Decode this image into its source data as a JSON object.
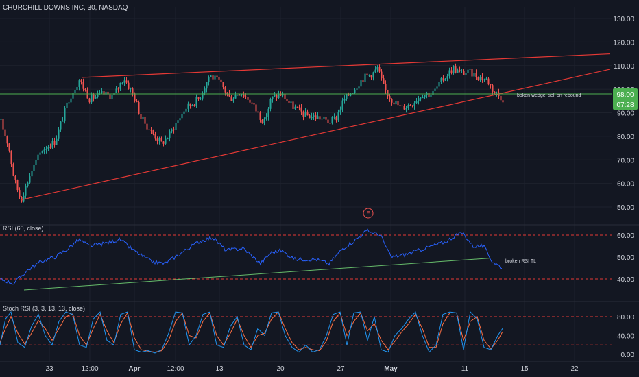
{
  "chart_title": "CHURCHILL DOWNS INC, 30, NASDAQ",
  "colors": {
    "background": "#131722",
    "up": "#26a69a",
    "down": "#ef5350",
    "wedge": "#e53935",
    "price_line": "#4caf50",
    "price_badge": "#4caf50",
    "rsi_line": "#2962ff",
    "rsi_trend": "#66bb6a",
    "stoch_k": "#2196f3",
    "stoch_d": "#ff7043",
    "level": "#e53935",
    "axis_text": "#d1d4dc"
  },
  "price_badge": {
    "price": "98.00",
    "countdown": "07:28"
  },
  "earnings_marker": "E",
  "chart_data": [
    {
      "type": "candlestick",
      "title": "CHURCHILL DOWNS INC, 30, NASDAQ",
      "ylim": [
        48,
        134
      ],
      "yticks": [
        "130.00",
        "120.00",
        "110.00",
        "100.00",
        "90.00",
        "80.00",
        "70.00",
        "60.00",
        "50.00"
      ],
      "xticks": [
        "23",
        "12:00",
        "Apr",
        "12:00",
        "13",
        "20",
        "27",
        "May",
        "11",
        "15",
        "22"
      ],
      "price_path": [
        [
          0,
          87
        ],
        [
          12,
          76
        ],
        [
          20,
          62
        ],
        [
          30,
          53
        ],
        [
          45,
          65
        ],
        [
          60,
          74
        ],
        [
          80,
          78
        ],
        [
          100,
          96
        ],
        [
          115,
          104
        ],
        [
          130,
          96
        ],
        [
          150,
          98
        ],
        [
          165,
          97
        ],
        [
          180,
          105
        ],
        [
          195,
          97
        ],
        [
          205,
          88
        ],
        [
          220,
          82
        ],
        [
          235,
          77
        ],
        [
          245,
          80
        ],
        [
          255,
          85
        ],
        [
          270,
          92
        ],
        [
          290,
          96
        ],
        [
          305,
          106
        ],
        [
          320,
          103
        ],
        [
          335,
          96
        ],
        [
          350,
          99
        ],
        [
          365,
          95
        ],
        [
          375,
          90
        ],
        [
          385,
          86
        ],
        [
          395,
          96
        ],
        [
          410,
          98
        ],
        [
          425,
          93
        ],
        [
          445,
          89
        ],
        [
          465,
          88
        ],
        [
          480,
          86
        ],
        [
          490,
          88
        ],
        [
          500,
          95
        ],
        [
          515,
          100
        ],
        [
          530,
          105
        ],
        [
          545,
          107
        ],
        [
          550,
          109
        ],
        [
          560,
          100
        ],
        [
          570,
          96
        ],
        [
          585,
          92
        ],
        [
          600,
          94
        ],
        [
          615,
          98
        ],
        [
          630,
          98
        ],
        [
          645,
          104
        ],
        [
          660,
          109
        ],
        [
          670,
          107
        ],
        [
          685,
          107
        ],
        [
          700,
          105
        ],
        [
          710,
          104
        ],
        [
          720,
          99
        ],
        [
          733,
          96
        ]
      ],
      "wedge_upper": {
        "from": {
          "x": 120,
          "price": 105
        },
        "to": {
          "x": 890,
          "price": 115
        }
      },
      "wedge_lower": {
        "from": {
          "x": 30,
          "price": 53
        },
        "to": {
          "x": 890,
          "price": 108.5
        }
      },
      "price_level": 98.0,
      "annotation": "boken wedge, sell on rebound"
    },
    {
      "type": "line",
      "title": "RSI (60, close)",
      "ylim": [
        34,
        66
      ],
      "yticks": [
        "60.00",
        "50.00",
        "40.00"
      ],
      "levels": [
        60,
        40
      ],
      "rsi_path": [
        [
          0,
          40
        ],
        [
          20,
          38
        ],
        [
          40,
          44
        ],
        [
          60,
          48
        ],
        [
          80,
          50
        ],
        [
          100,
          54
        ],
        [
          115,
          58
        ],
        [
          130,
          55
        ],
        [
          150,
          56
        ],
        [
          175,
          58
        ],
        [
          195,
          53
        ],
        [
          220,
          48
        ],
        [
          240,
          47
        ],
        [
          270,
          53
        ],
        [
          290,
          57
        ],
        [
          310,
          59
        ],
        [
          330,
          53
        ],
        [
          355,
          54
        ],
        [
          380,
          47
        ],
        [
          395,
          52
        ],
        [
          410,
          53
        ],
        [
          430,
          49
        ],
        [
          460,
          49
        ],
        [
          480,
          47
        ],
        [
          500,
          54
        ],
        [
          515,
          57
        ],
        [
          535,
          62
        ],
        [
          555,
          60
        ],
        [
          570,
          50
        ],
        [
          590,
          51
        ],
        [
          610,
          53
        ],
        [
          630,
          55
        ],
        [
          650,
          57
        ],
        [
          665,
          60
        ],
        [
          675,
          61
        ],
        [
          690,
          55
        ],
        [
          705,
          55
        ],
        [
          718,
          48
        ],
        [
          733,
          45
        ]
      ],
      "trendline": {
        "from": {
          "x": 35,
          "value": 35
        },
        "to": {
          "x": 715,
          "value": 49.5
        }
      },
      "annotation": "broken RSI TL"
    },
    {
      "type": "line",
      "title": "Stoch RSI (3, 3, 13, 13, close)",
      "ylim": [
        -5,
        100
      ],
      "yticks": [
        "80.00",
        "40.00",
        "0.00"
      ],
      "levels": [
        80,
        20
      ],
      "stoch_k": [
        [
          0,
          20
        ],
        [
          8,
          75
        ],
        [
          16,
          90
        ],
        [
          26,
          25
        ],
        [
          36,
          15
        ],
        [
          46,
          60
        ],
        [
          56,
          85
        ],
        [
          66,
          40
        ],
        [
          76,
          20
        ],
        [
          86,
          70
        ],
        [
          96,
          90
        ],
        [
          106,
          85
        ],
        [
          116,
          20
        ],
        [
          126,
          15
        ],
        [
          136,
          75
        ],
        [
          146,
          90
        ],
        [
          156,
          30
        ],
        [
          166,
          20
        ],
        [
          176,
          85
        ],
        [
          186,
          90
        ],
        [
          196,
          10
        ],
        [
          206,
          5
        ],
        [
          216,
          8
        ],
        [
          226,
          3
        ],
        [
          236,
          10
        ],
        [
          246,
          45
        ],
        [
          256,
          90
        ],
        [
          266,
          88
        ],
        [
          276,
          20
        ],
        [
          286,
          40
        ],
        [
          296,
          85
        ],
        [
          306,
          90
        ],
        [
          316,
          20
        ],
        [
          326,
          15
        ],
        [
          336,
          60
        ],
        [
          346,
          80
        ],
        [
          356,
          20
        ],
        [
          366,
          10
        ],
        [
          376,
          55
        ],
        [
          386,
          40
        ],
        [
          396,
          88
        ],
        [
          406,
          90
        ],
        [
          416,
          40
        ],
        [
          426,
          15
        ],
        [
          436,
          5
        ],
        [
          446,
          20
        ],
        [
          456,
          5
        ],
        [
          466,
          10
        ],
        [
          476,
          40
        ],
        [
          486,
          85
        ],
        [
          496,
          90
        ],
        [
          506,
          20
        ],
        [
          516,
          88
        ],
        [
          526,
          90
        ],
        [
          536,
          30
        ],
        [
          546,
          80
        ],
        [
          556,
          10
        ],
        [
          566,
          5
        ],
        [
          576,
          40
        ],
        [
          586,
          55
        ],
        [
          596,
          75
        ],
        [
          606,
          90
        ],
        [
          616,
          40
        ],
        [
          626,
          5
        ],
        [
          636,
          20
        ],
        [
          646,
          85
        ],
        [
          656,
          90
        ],
        [
          666,
          88
        ],
        [
          676,
          10
        ],
        [
          686,
          90
        ],
        [
          696,
          75
        ],
        [
          706,
          15
        ],
        [
          716,
          10
        ],
        [
          726,
          40
        ],
        [
          733,
          55
        ]
      ],
      "stoch_d": [
        [
          0,
          25
        ],
        [
          8,
          55
        ],
        [
          16,
          80
        ],
        [
          26,
          45
        ],
        [
          36,
          22
        ],
        [
          46,
          45
        ],
        [
          56,
          72
        ],
        [
          66,
          55
        ],
        [
          76,
          30
        ],
        [
          86,
          55
        ],
        [
          96,
          80
        ],
        [
          106,
          86
        ],
        [
          116,
          40
        ],
        [
          126,
          20
        ],
        [
          136,
          55
        ],
        [
          146,
          85
        ],
        [
          156,
          50
        ],
        [
          166,
          25
        ],
        [
          176,
          65
        ],
        [
          186,
          88
        ],
        [
          196,
          35
        ],
        [
          206,
          10
        ],
        [
          216,
          7
        ],
        [
          226,
          5
        ],
        [
          236,
          8
        ],
        [
          246,
          30
        ],
        [
          256,
          70
        ],
        [
          266,
          88
        ],
        [
          276,
          40
        ],
        [
          286,
          35
        ],
        [
          296,
          70
        ],
        [
          306,
          88
        ],
        [
          316,
          40
        ],
        [
          326,
          20
        ],
        [
          336,
          45
        ],
        [
          346,
          75
        ],
        [
          356,
          40
        ],
        [
          366,
          15
        ],
        [
          376,
          40
        ],
        [
          386,
          45
        ],
        [
          396,
          75
        ],
        [
          406,
          90
        ],
        [
          416,
          55
        ],
        [
          426,
          25
        ],
        [
          436,
          10
        ],
        [
          446,
          15
        ],
        [
          456,
          10
        ],
        [
          466,
          8
        ],
        [
          476,
          28
        ],
        [
          486,
          70
        ],
        [
          496,
          88
        ],
        [
          506,
          40
        ],
        [
          516,
          70
        ],
        [
          526,
          88
        ],
        [
          536,
          50
        ],
        [
          546,
          65
        ],
        [
          556,
          30
        ],
        [
          566,
          10
        ],
        [
          576,
          28
        ],
        [
          586,
          48
        ],
        [
          596,
          65
        ],
        [
          606,
          85
        ],
        [
          616,
          55
        ],
        [
          626,
          15
        ],
        [
          636,
          15
        ],
        [
          646,
          65
        ],
        [
          656,
          88
        ],
        [
          666,
          88
        ],
        [
          676,
          30
        ],
        [
          686,
          70
        ],
        [
          696,
          80
        ],
        [
          706,
          30
        ],
        [
          716,
          12
        ],
        [
          726,
          30
        ],
        [
          733,
          48
        ]
      ]
    }
  ]
}
